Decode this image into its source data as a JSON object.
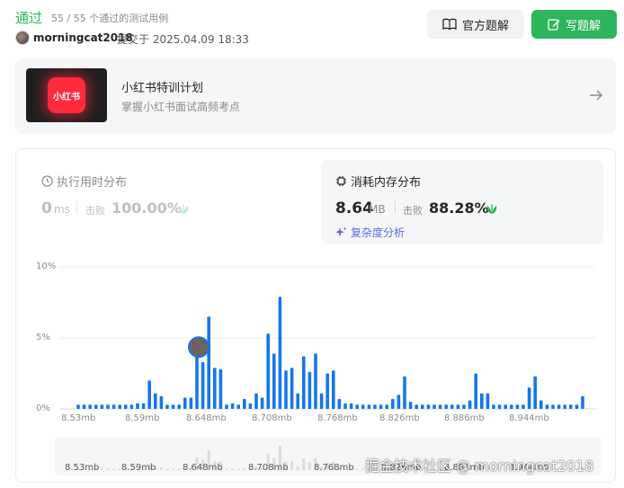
{
  "header": {
    "status": "通过",
    "pass_count": "55 / 55 个通过的测试用例",
    "user": "morningcat2018",
    "submitted": "提交于 2025.04.09 18:33",
    "official_solution": "官方题解",
    "write_solution": "写题解"
  },
  "promo": {
    "image_text": "小红书",
    "title": "小红书特训计划",
    "subtitle": "掌握小红书面试高频考点"
  },
  "runtime": {
    "title": "执行用时分布",
    "value": "0",
    "unit": "ms",
    "beat_label": "击败",
    "beat_pct": "100.00%"
  },
  "memory": {
    "title": "消耗内存分布",
    "value": "8.64",
    "unit": "MB",
    "beat_label": "击败",
    "beat_pct": "88.28%",
    "complexity_link": "复杂度分析"
  },
  "colors": {
    "accent": "#2db55d",
    "bar": "#1677e8",
    "gray": "#8c8c8c"
  },
  "chart_data": {
    "type": "bar",
    "y_tick_labels": [
      "10%",
      "5%",
      "0%"
    ],
    "ylim": [
      0,
      10
    ],
    "x_tick_labels": [
      "8.53mb",
      "8.59mb",
      "8.648mb",
      "8.708mb",
      "8.768mb",
      "8.826mb",
      "8.886mb",
      "8.944mb"
    ],
    "values": [
      0.3,
      0.3,
      0.3,
      0.3,
      0.3,
      0.3,
      0.3,
      0.3,
      0.3,
      0.3,
      0.4,
      0.4,
      2.0,
      1.1,
      0.9,
      0.3,
      0.3,
      0.3,
      0.8,
      0.8,
      4.1,
      3.3,
      6.5,
      2.9,
      2.8,
      0.3,
      0.4,
      0.3,
      0.7,
      0.4,
      1.1,
      0.8,
      5.3,
      3.9,
      7.9,
      2.7,
      2.9,
      1.1,
      3.7,
      2.6,
      3.9,
      1.1,
      2.5,
      2.7,
      0.7,
      0.4,
      0.4,
      0.3,
      0.3,
      0.3,
      0.3,
      0.3,
      0.3,
      0.7,
      1.0,
      2.3,
      0.5,
      0.3,
      0.3,
      0.3,
      0.3,
      0.3,
      0.3,
      0.3,
      0.3,
      0.3,
      0.6,
      2.5,
      1.1,
      1.1,
      0.3,
      0.3,
      0.3,
      0.3,
      0.3,
      0.3,
      1.5,
      2.3,
      0.6,
      0.3,
      0.3,
      0.3,
      0.3,
      0.3,
      0.3,
      0.9
    ],
    "marker_index": 20
  },
  "mini_chart": {
    "labels": [
      "8.53mb",
      "8.59mb",
      "8.648mb",
      "8.708mb",
      "8.768mb",
      "8.826mb",
      "8.886mb",
      "8.944mb"
    ]
  },
  "watermark": "掘金技术社区 @ morningcat2018"
}
